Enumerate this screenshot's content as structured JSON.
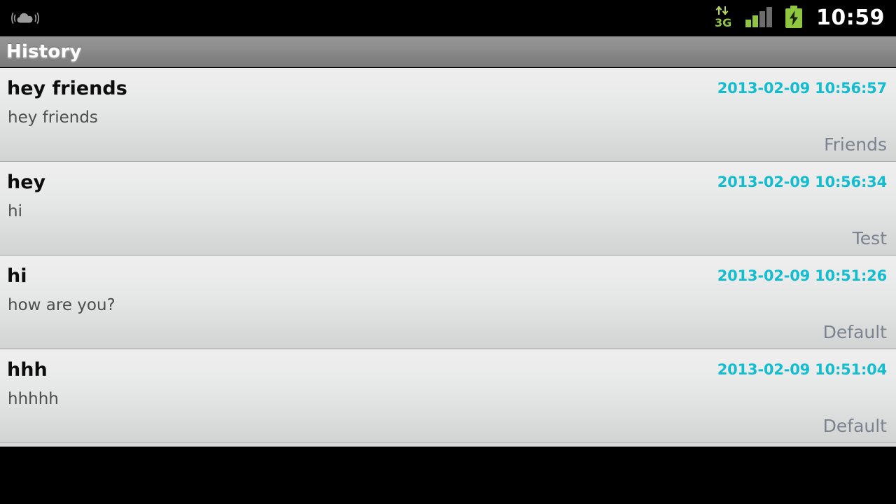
{
  "status_bar": {
    "notification_icon": "cloud-sound-icon",
    "network_icon": "3g-data-icon",
    "network_label": "3G",
    "signal_icon": "signal-bars-icon",
    "signal_bars_filled": 2,
    "signal_bars_total": 4,
    "battery_icon": "battery-charging-icon",
    "time": "10:59"
  },
  "title_bar": {
    "title": "History"
  },
  "colors": {
    "accent_timestamp": "#13bdd0",
    "title_bar_gray": "#8d8d8d",
    "tag_gray": "#7b838f",
    "battery_green": "#8ec640",
    "signal_green": "#8ec640"
  },
  "history": {
    "items": [
      {
        "title": "hey friends",
        "subtitle": "hey friends",
        "timestamp": "2013-02-09 10:56:57",
        "tag": "Friends"
      },
      {
        "title": "hey",
        "subtitle": "hi",
        "timestamp": "2013-02-09 10:56:34",
        "tag": "Test"
      },
      {
        "title": "hi",
        "subtitle": "how are you?",
        "timestamp": "2013-02-09 10:51:26",
        "tag": "Default"
      },
      {
        "title": "hhh",
        "subtitle": "hhhhh",
        "timestamp": "2013-02-09 10:51:04",
        "tag": "Default"
      }
    ]
  }
}
